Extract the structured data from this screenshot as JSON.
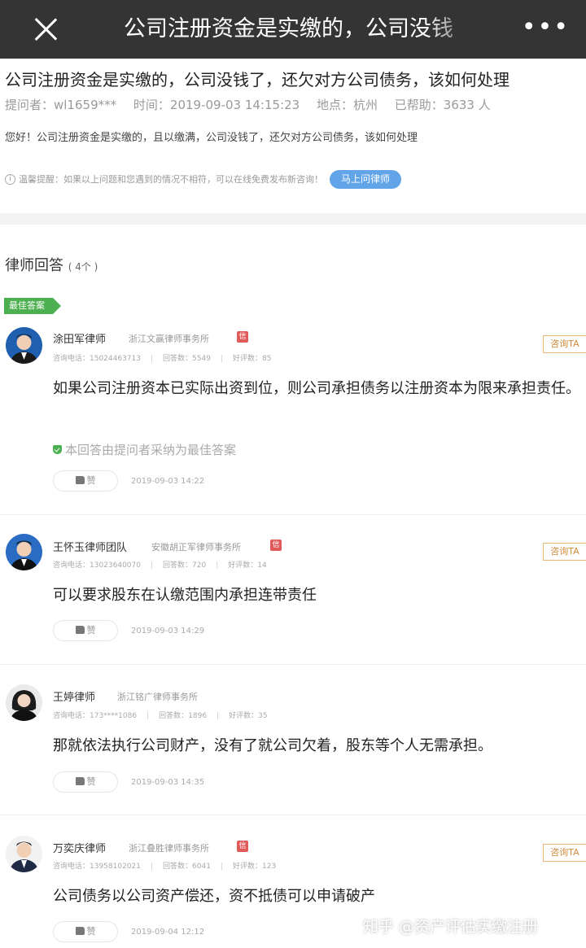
{
  "topbar": {
    "title": "公司注册资金是实缴的，公司没钱",
    "more": "•••"
  },
  "question": {
    "title": "公司注册资金是实缴的，公司没钱了，还欠对方公司债务，该如何处理",
    "asker": "提问者：wl1659***",
    "time": "时间：2019-09-03 14:15:23",
    "location": "地点：杭州",
    "helped": "已帮助：3633 人",
    "body": "您好！公司注册资金是实缴的，且以缴满，公司没钱了，还欠对方公司债务，该如何处理",
    "tip": "温馨提醒：如果以上问题和您遇到的情况不相符，可以在线免费发布新咨询！",
    "ask_button": "马上问律师"
  },
  "answers_header": {
    "label": "律师回答",
    "count": "( 4个 )"
  },
  "best_badge": "最佳答案",
  "consult_label": "咨询TA",
  "like_label": "赞",
  "xin_label": "信",
  "adopt_note": "本回答由提问者采纳为最佳答案",
  "answers": [
    {
      "name": "涂田军律师",
      "firm": "浙江文赢律师事务所",
      "verified": true,
      "phone": "咨询电话：15024463713",
      "answers": "回答数：5549",
      "good": "好评数：85",
      "content": "如果公司注册资本已实际出资到位，则公司承担债务以注册资本为限来承担责任。",
      "date": "2019-09-03 14:22",
      "best": true
    },
    {
      "name": "王怀玉律师团队",
      "firm": "安徽胡正军律师事务所",
      "verified": true,
      "phone": "咨询电话：13023640070",
      "answers": "回答数：720",
      "good": "好评数：14",
      "content": "可以要求股东在认缴范围内承担连带责任",
      "date": "2019-09-03 14:29",
      "best": false
    },
    {
      "name": "王婷律师",
      "firm": "浙江铭广律师事务所",
      "verified": false,
      "phone": "咨询电话：173****1086",
      "answers": "回答数：1896",
      "good": "好评数：35",
      "content": "那就依法执行公司财产，没有了就公司欠着，股东等个人无需承担。",
      "date": "2019-09-03 14:35",
      "best": false
    },
    {
      "name": "万奕庆律师",
      "firm": "浙江叠胜律师事务所",
      "verified": true,
      "phone": "咨询电话：13958102021",
      "answers": "回答数：6041",
      "good": "好评数：123",
      "content": "公司债务以公司资产偿还，资不抵债可以申请破产",
      "date": "2019-09-04 12:12",
      "best": false
    }
  ],
  "watermark": "知乎 @资产评估实缴注册"
}
